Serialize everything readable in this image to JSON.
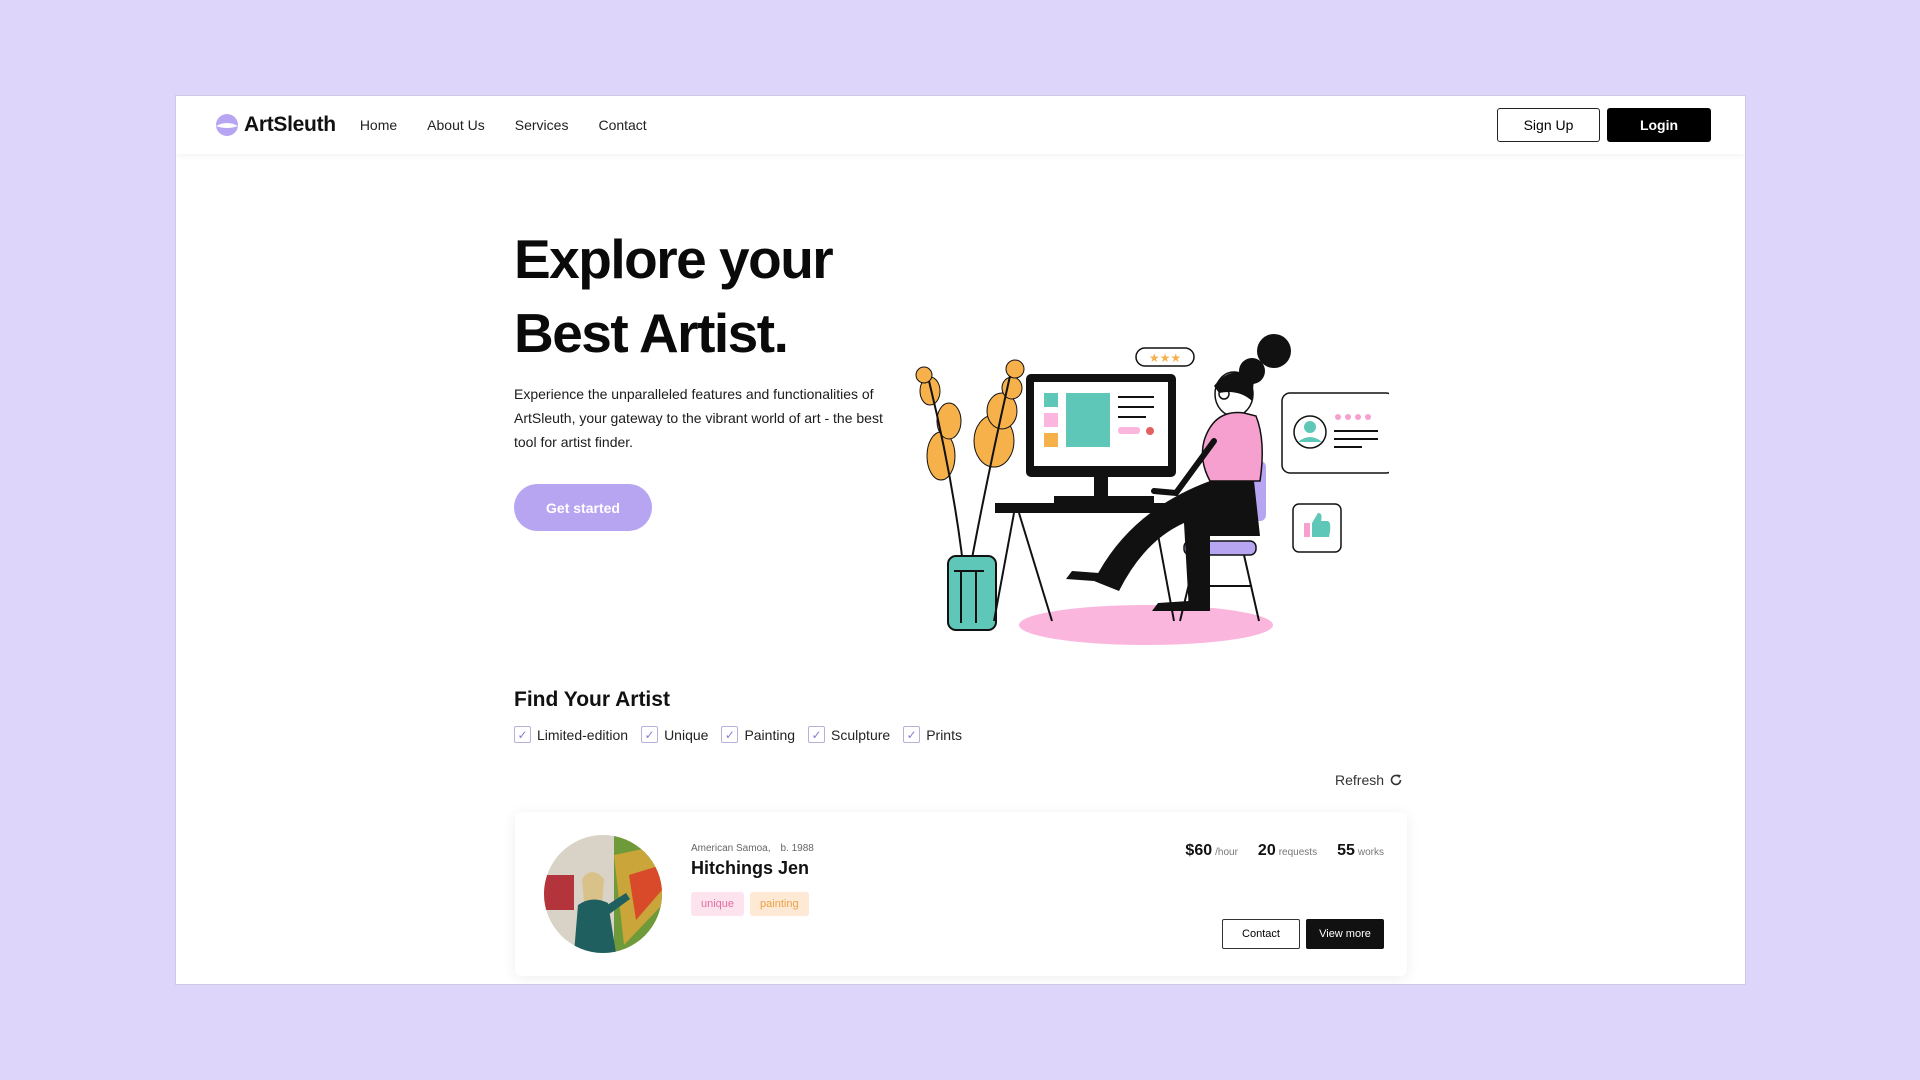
{
  "brand": {
    "name": "ArtSleuth",
    "accent": "#b7a5f2"
  },
  "nav": {
    "links": [
      "Home",
      "About Us",
      "Services",
      "Contact"
    ],
    "signup_label": "Sign Up",
    "login_label": "Login"
  },
  "hero": {
    "title_line1": "Explore your",
    "title_line2": "Best Artist.",
    "description": "Experience the unparalleled features and functionalities of ArtSleuth, your gateway to the vibrant world of art - the best tool for artist finder.",
    "cta_label": "Get started"
  },
  "finder": {
    "title": "Find Your Artist",
    "filters": [
      {
        "label": "Limited-edition",
        "checked": true
      },
      {
        "label": "Unique",
        "checked": true
      },
      {
        "label": "Painting",
        "checked": true
      },
      {
        "label": "Sculpture",
        "checked": true
      },
      {
        "label": "Prints",
        "checked": true
      }
    ],
    "refresh_label": "Refresh"
  },
  "artist": {
    "location": "American Samoa,",
    "birth": "b. 1988",
    "name": "Hitchings Jen",
    "tags": [
      "unique",
      "painting"
    ],
    "rate": "$60",
    "rate_unit": "/hour",
    "requests": "20",
    "requests_unit": "requests",
    "works": "55",
    "works_unit": "works",
    "contact_label": "Contact",
    "view_more_label": "View more"
  }
}
